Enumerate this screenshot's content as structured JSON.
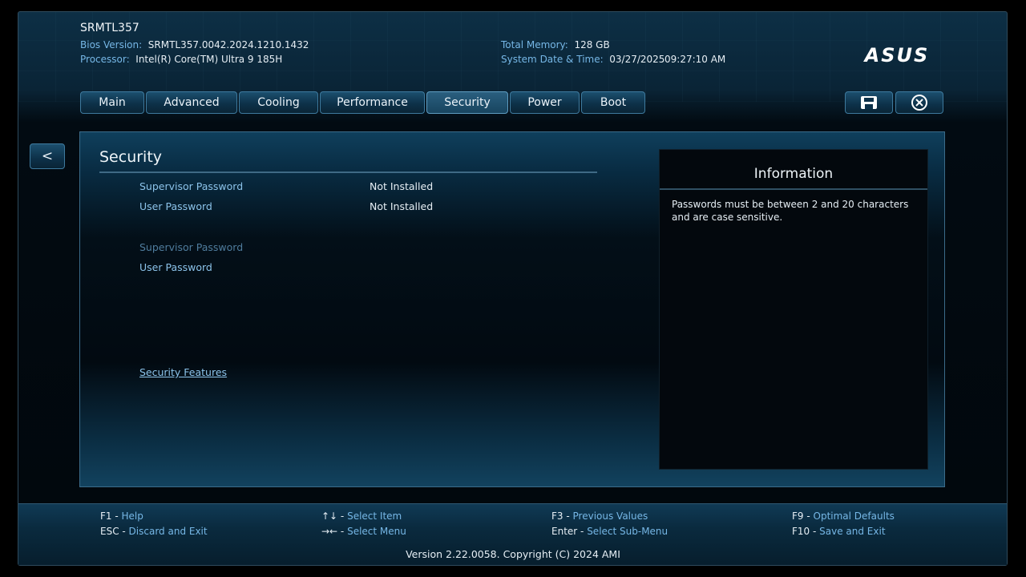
{
  "header": {
    "hostname": "SRMTL357",
    "bios_version_label": "Bios Version:",
    "bios_version": "SRMTL357.0042.2024.1210.1432",
    "processor_label": "Processor:",
    "processor": "Intel(R) Core(TM) Ultra 9 185H",
    "total_memory_label": "Total Memory:",
    "total_memory": "128 GB",
    "datetime_label": "System Date & Time:",
    "date": "03/27/2025",
    "time": "09:27:10 AM",
    "logo": "ASUS"
  },
  "tabs": [
    {
      "label": "Main"
    },
    {
      "label": "Advanced"
    },
    {
      "label": "Cooling"
    },
    {
      "label": "Performance"
    },
    {
      "label": "Security"
    },
    {
      "label": "Power"
    },
    {
      "label": "Boot"
    }
  ],
  "active_tab": "Security",
  "toolbar": {
    "save_icon": "save-icon",
    "exit_icon": "close-circle-icon"
  },
  "nav": {
    "back_label": "<"
  },
  "page": {
    "title": "Security",
    "status_rows": [
      {
        "label": "Supervisor Password",
        "value": "Not Installed"
      },
      {
        "label": "User Password",
        "value": "Not Installed"
      }
    ],
    "settings": [
      {
        "label": "Supervisor Password",
        "disabled": true
      },
      {
        "label": "User Password",
        "disabled": false
      }
    ],
    "submenu_link": "Security Features"
  },
  "info": {
    "title": "Information",
    "text": "Passwords must be between 2 and 20 characters and are case sensitive."
  },
  "hotkeys": {
    "f1_key": "F1",
    "f1_action": "Help",
    "esc_key": "ESC",
    "esc_action": "Discard and Exit",
    "updown_key": "↑↓",
    "updown_action": "Select Item",
    "leftright_key": "→←",
    "leftright_action": "Select Menu",
    "f3_key": "F3",
    "f3_action": "Previous Values",
    "enter_key": "Enter",
    "enter_action": "Select Sub-Menu",
    "f9_key": "F9",
    "f9_action": "Optimal Defaults",
    "f10_key": "F10",
    "f10_action": "Save and Exit"
  },
  "footer": {
    "version": "Version 2.22.0058. Copyright (C) 2024 AMI"
  },
  "colors": {
    "accent_label": "#76b7e6",
    "item_label": "#8cc3ea",
    "disabled_label": "#4f7c9d",
    "tab_border": "#3e7a9e"
  }
}
